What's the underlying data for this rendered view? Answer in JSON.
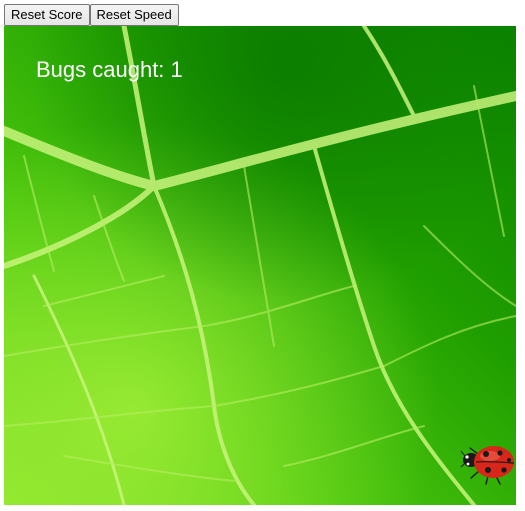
{
  "toolbar": {
    "reset_score_label": "Reset Score",
    "reset_speed_label": "Reset Speed"
  },
  "game": {
    "score_label": "Bugs caught: 1",
    "bugs_caught": 1,
    "background": "leaf",
    "bug": "ladybug-icon"
  },
  "colors": {
    "leaf_dark": "#0f8a00",
    "leaf_mid": "#3fc20a",
    "leaf_light": "#8be62a",
    "vein": "#c8f27a",
    "ladybug_red": "#d8261a",
    "ladybug_black": "#1a1a1a",
    "score_text": "#ffffff"
  }
}
